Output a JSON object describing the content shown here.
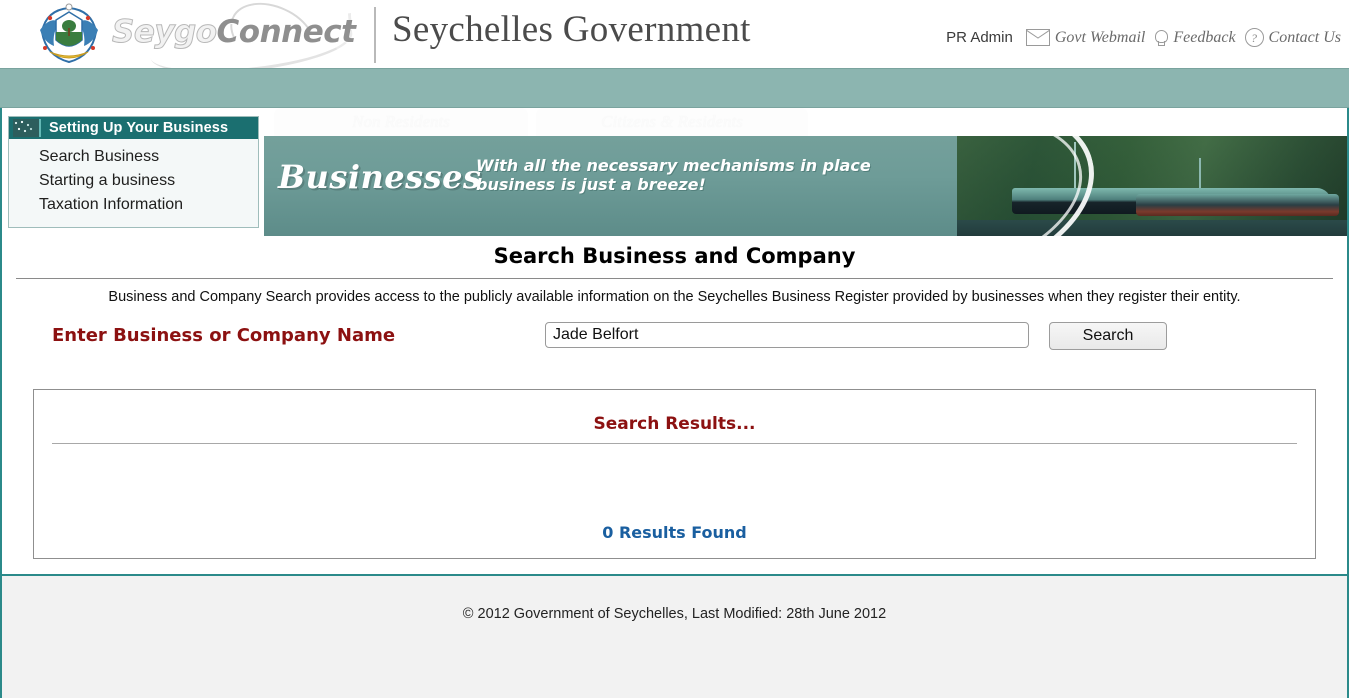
{
  "header": {
    "brand_primary": "Seygo",
    "brand_secondary": "Connect",
    "site_title": "Seychelles Government",
    "user_label": "PR Admin",
    "links": [
      {
        "label": "Govt Webmail",
        "icon": "mail-icon"
      },
      {
        "label": "Feedback",
        "icon": "lightbulb-icon"
      },
      {
        "label": "Contact Us",
        "icon": "question-mark-icon"
      }
    ]
  },
  "sidebar": {
    "title": "Setting Up Your Business",
    "items": [
      {
        "label": "Search Business"
      },
      {
        "label": "Starting a business"
      },
      {
        "label": "Taxation Information"
      }
    ]
  },
  "banner": {
    "tabs": [
      {
        "label": "Non Residents"
      },
      {
        "label": "Citizens & Residents"
      }
    ],
    "headline": "Businesses",
    "tagline_line1": "With all the necessary mechanisms in place",
    "tagline_line2": "business is just a breeze!"
  },
  "main": {
    "page_title": "Search Business and Company",
    "intro": "Business and Company Search provides access to the publicly available information on the Seychelles Business Register provided by businesses when they register their entity.",
    "search_label": "Enter Business or Company Name",
    "search_value": "Jade Belfort",
    "search_placeholder": "",
    "search_button": "Search",
    "results_title": "Search Results...",
    "results_count": "0 Results Found"
  },
  "footer": {
    "text": "© 2012 Government of Seychelles, Last Modified: 28th June 2012"
  },
  "colors": {
    "teal_bar": "#8cb5b0",
    "frame_border": "#2b8a8a",
    "sidebar_header": "#1b6f70",
    "accent_red": "#8c1111",
    "accent_blue": "#1a5fa0",
    "footer_bg": "#f2f2f2"
  }
}
